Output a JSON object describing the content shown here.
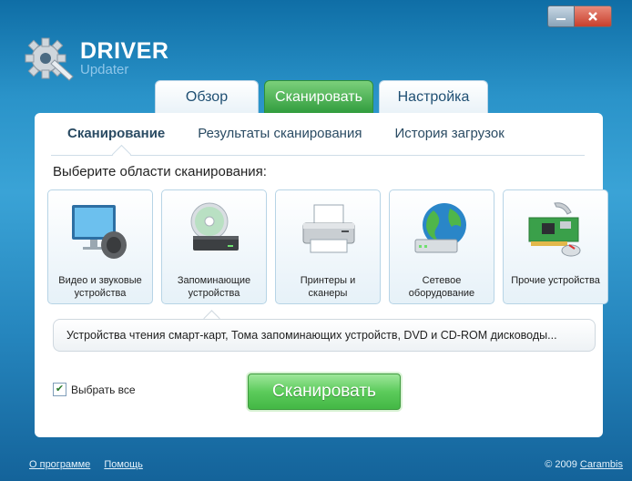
{
  "window": {
    "minimize_icon": "minimize-icon",
    "close_icon": "close-icon"
  },
  "logo": {
    "title": "DRIVER",
    "subtitle": "Updater"
  },
  "tabs": [
    {
      "label": "Обзор"
    },
    {
      "label": "Сканировать",
      "active": true
    },
    {
      "label": "Настройка"
    }
  ],
  "subtabs": [
    {
      "label": "Сканирование",
      "active": true
    },
    {
      "label": "Результаты сканирования"
    },
    {
      "label": "История загрузок"
    }
  ],
  "prompt": "Выберите области сканирования:",
  "categories": [
    {
      "label": "Видео и звуковые устройства",
      "icon": "monitor-speaker-icon"
    },
    {
      "label": "Запоминающие устройства",
      "icon": "disc-drive-icon"
    },
    {
      "label": "Принтеры и сканеры",
      "icon": "printer-icon"
    },
    {
      "label": "Сетевое оборудование",
      "icon": "globe-network-icon"
    },
    {
      "label": "Прочие устройства",
      "icon": "pci-card-icon"
    }
  ],
  "description": "Устройства чтения смарт-карт, Тома запоминающих устройств, DVD и CD-ROM дисководы...",
  "select_all": {
    "label": "Выбрать все",
    "checked": true
  },
  "scan_button": "Сканировать",
  "footer": {
    "about": "О программе",
    "help": "Помощь",
    "copyright_prefix": "© 2009",
    "company": "Carambis"
  },
  "colors": {
    "accent_green": "#43b845",
    "accent_blue": "#2a93c9"
  }
}
